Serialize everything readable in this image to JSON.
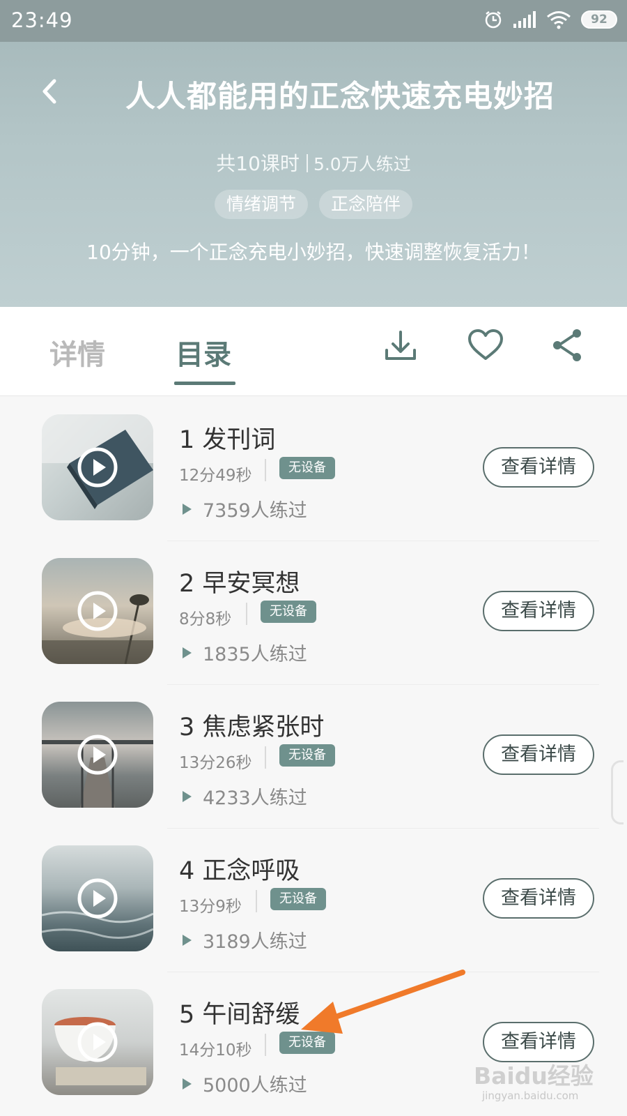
{
  "status_bar": {
    "time": "23:49",
    "battery": "92"
  },
  "header": {
    "title": "人人都能用的正念快速充电妙招",
    "lessons_count": "共10课时",
    "practice_count": "5.0万人练过",
    "tags": [
      "情绪调节",
      "正念陪伴"
    ],
    "description": "10分钟，一个正念充电小妙招，快速调整恢复活力！"
  },
  "tabs": {
    "detail": "详情",
    "catalog": "目录",
    "active": "目录"
  },
  "lessons": [
    {
      "title": "1 发刊词",
      "duration": "12分49秒",
      "badge": "无设备",
      "practice": "7359人练过",
      "button": "查看详情"
    },
    {
      "title": "2 早安冥想",
      "duration": "8分8秒",
      "badge": "无设备",
      "practice": "1835人练过",
      "button": "查看详情"
    },
    {
      "title": "3 焦虑紧张时",
      "duration": "13分26秒",
      "badge": "无设备",
      "practice": "4233人练过",
      "button": "查看详情"
    },
    {
      "title": "4 正念呼吸",
      "duration": "13分9秒",
      "badge": "无设备",
      "practice": "3189人练过",
      "button": "查看详情"
    },
    {
      "title": "5 午间舒缓",
      "duration": "14分10秒",
      "badge": "无设备",
      "practice": "5000人练过",
      "button": "查看详情"
    }
  ],
  "watermark": {
    "brand": "Baidu经验",
    "site": "jingyan.baidu.com"
  },
  "colors": {
    "accent": "#5b7a76",
    "badge": "#6f918d",
    "header": "#b3c5c7",
    "annotation_arrow": "#f07a2a"
  }
}
